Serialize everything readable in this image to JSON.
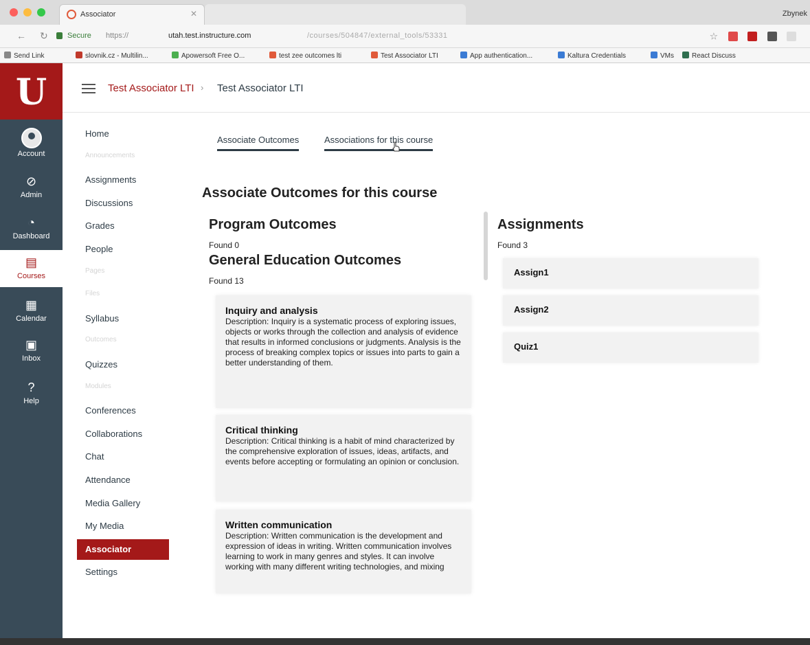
{
  "browser": {
    "tab_title": "Associator",
    "profile_name": "Zbynek",
    "secure_label": "Secure",
    "url_scheme": "https://",
    "url_host": "utah.test.instructure.com",
    "url_path": "/courses/504847/external_tools/53331",
    "bookmarks": [
      {
        "label": "Send Link",
        "color": "#888888"
      },
      {
        "label": "slovnik.cz - Multilin...",
        "color": "#c0392b"
      },
      {
        "label": "Apowersoft Free O...",
        "color": "#4caf50"
      },
      {
        "label": "test zee outcomes lti",
        "color": "#e05a3a"
      },
      {
        "label": "Test Associator LTI",
        "color": "#e05a3a"
      },
      {
        "label": "App authentication...",
        "color": "#3b7bd4"
      },
      {
        "label": "Kaltura Credentials",
        "color": "#3b7bd4"
      },
      {
        "label": "VMs",
        "color": "#3b7bd4"
      },
      {
        "label": "React Discuss",
        "color": "#2f6f4f"
      }
    ]
  },
  "global_nav": {
    "logo": "U",
    "items": [
      {
        "label": "Account",
        "icon": "avatar-icon"
      },
      {
        "label": "Admin",
        "icon": "admin-icon",
        "glyph": "⊘"
      },
      {
        "label": "Dashboard",
        "icon": "dashboard-icon",
        "glyph": "◔"
      },
      {
        "label": "Courses",
        "icon": "courses-icon",
        "glyph": "▤"
      },
      {
        "label": "Calendar",
        "icon": "calendar-icon",
        "glyph": "▦"
      },
      {
        "label": "Inbox",
        "icon": "inbox-icon",
        "glyph": "▣"
      },
      {
        "label": "Help",
        "icon": "help-icon",
        "glyph": "?"
      }
    ],
    "brand_color": "#a41919",
    "nav_color": "#394b58"
  },
  "breadcrumb": {
    "course": "Test Associator LTI",
    "separator": "›",
    "page": "Test Associator LTI"
  },
  "course_nav": {
    "items": [
      {
        "label": "Home",
        "hidden": false
      },
      {
        "label": "Announcements",
        "hidden": true
      },
      {
        "label": "Assignments",
        "hidden": false
      },
      {
        "label": "Discussions",
        "hidden": false
      },
      {
        "label": "Grades",
        "hidden": false
      },
      {
        "label": "People",
        "hidden": false
      },
      {
        "label": "Pages",
        "hidden": true
      },
      {
        "label": "Files",
        "hidden": true
      },
      {
        "label": "Syllabus",
        "hidden": false
      },
      {
        "label": "Outcomes",
        "hidden": true
      },
      {
        "label": "Quizzes",
        "hidden": false
      },
      {
        "label": "Modules",
        "hidden": true
      },
      {
        "label": "Conferences",
        "hidden": false
      },
      {
        "label": "Collaborations",
        "hidden": false
      },
      {
        "label": "Chat",
        "hidden": false
      },
      {
        "label": "Attendance",
        "hidden": false
      },
      {
        "label": "Media Gallery",
        "hidden": false
      },
      {
        "label": "My Media",
        "hidden": false
      },
      {
        "label": "Associator",
        "hidden": false,
        "active": true
      },
      {
        "label": "Settings",
        "hidden": false
      }
    ]
  },
  "tool": {
    "tabs": [
      "Associate Outcomes",
      "Associations for this course"
    ],
    "page_title": "Associate Outcomes for this course",
    "program_outcomes": {
      "heading": "Program Outcomes",
      "found": "Found 0"
    },
    "gen_ed_outcomes": {
      "heading": "General Education Outcomes",
      "found": "Found 13",
      "items": [
        {
          "title": "Inquiry and analysis",
          "description": "Description: Inquiry is a systematic process of exploring issues, objects or works through the collection and analysis of evidence that results in informed conclusions or judgments. Analysis is the process of breaking complex topics or issues into parts to gain a better understanding of them."
        },
        {
          "title": "Critical thinking",
          "description": "Description: Critical thinking is a habit of mind characterized by the comprehensive exploration of issues, ideas, artifacts, and events before accepting or formulating an opinion or conclusion."
        },
        {
          "title": "Written communication",
          "description": "Description: Written communication is the development and expression of ideas in writing. Written communication involves learning to work in many genres and styles. It can involve working with many different writing technologies, and mixing"
        }
      ]
    },
    "assignments": {
      "heading": "Assignments",
      "found": "Found 3",
      "items": [
        "Assign1",
        "Assign2",
        "Quiz1"
      ]
    }
  }
}
